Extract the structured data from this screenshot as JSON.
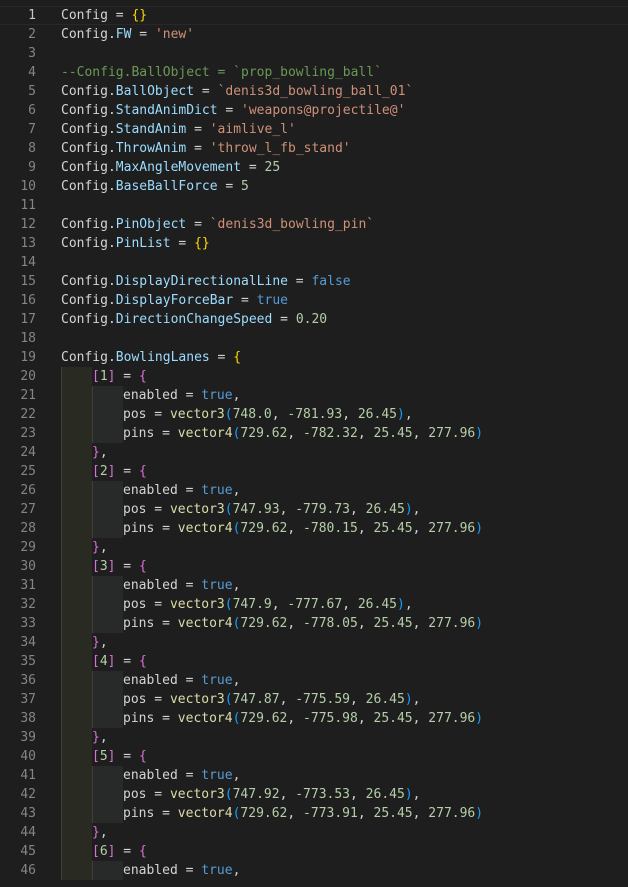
{
  "editor": {
    "current_line": "1",
    "lines": [
      {
        "n": "1",
        "indent": 0,
        "tokens": [
          [
            "id",
            "Config"
          ],
          [
            "op",
            " = "
          ],
          [
            "b1",
            "{}"
          ]
        ]
      },
      {
        "n": "2",
        "indent": 0,
        "tokens": [
          [
            "id",
            "Config"
          ],
          [
            "op",
            "."
          ],
          [
            "prop",
            "FW"
          ],
          [
            "op",
            " = "
          ],
          [
            "str",
            "'new'"
          ]
        ]
      },
      {
        "n": "3",
        "indent": 0,
        "tokens": []
      },
      {
        "n": "4",
        "indent": 0,
        "tokens": [
          [
            "cmt",
            "--Config.BallObject = `prop_bowling_ball`"
          ]
        ]
      },
      {
        "n": "5",
        "indent": 0,
        "tokens": [
          [
            "id",
            "Config"
          ],
          [
            "op",
            "."
          ],
          [
            "prop",
            "BallObject"
          ],
          [
            "op",
            " = "
          ],
          [
            "str",
            "`denis3d_bowling_ball_01`"
          ]
        ]
      },
      {
        "n": "6",
        "indent": 0,
        "tokens": [
          [
            "id",
            "Config"
          ],
          [
            "op",
            "."
          ],
          [
            "prop",
            "StandAnimDict"
          ],
          [
            "op",
            " = "
          ],
          [
            "str",
            "'weapons@projectile@'"
          ]
        ]
      },
      {
        "n": "7",
        "indent": 0,
        "tokens": [
          [
            "id",
            "Config"
          ],
          [
            "op",
            "."
          ],
          [
            "prop",
            "StandAnim"
          ],
          [
            "op",
            " = "
          ],
          [
            "str",
            "'aimlive_l'"
          ]
        ]
      },
      {
        "n": "8",
        "indent": 0,
        "tokens": [
          [
            "id",
            "Config"
          ],
          [
            "op",
            "."
          ],
          [
            "prop",
            "ThrowAnim"
          ],
          [
            "op",
            " = "
          ],
          [
            "str",
            "'throw_l_fb_stand'"
          ]
        ]
      },
      {
        "n": "9",
        "indent": 0,
        "tokens": [
          [
            "id",
            "Config"
          ],
          [
            "op",
            "."
          ],
          [
            "prop",
            "MaxAngleMovement"
          ],
          [
            "op",
            " = "
          ],
          [
            "num",
            "25"
          ]
        ]
      },
      {
        "n": "10",
        "indent": 0,
        "tokens": [
          [
            "id",
            "Config"
          ],
          [
            "op",
            "."
          ],
          [
            "prop",
            "BaseBallForce"
          ],
          [
            "op",
            " = "
          ],
          [
            "num",
            "5"
          ]
        ]
      },
      {
        "n": "11",
        "indent": 0,
        "tokens": []
      },
      {
        "n": "12",
        "indent": 0,
        "tokens": [
          [
            "id",
            "Config"
          ],
          [
            "op",
            "."
          ],
          [
            "prop",
            "PinObject"
          ],
          [
            "op",
            " = "
          ],
          [
            "str",
            "`denis3d_bowling_pin`"
          ]
        ]
      },
      {
        "n": "13",
        "indent": 0,
        "tokens": [
          [
            "id",
            "Config"
          ],
          [
            "op",
            "."
          ],
          [
            "prop",
            "PinList"
          ],
          [
            "op",
            " = "
          ],
          [
            "b1",
            "{}"
          ]
        ]
      },
      {
        "n": "14",
        "indent": 0,
        "tokens": []
      },
      {
        "n": "15",
        "indent": 0,
        "tokens": [
          [
            "id",
            "Config"
          ],
          [
            "op",
            "."
          ],
          [
            "prop",
            "DisplayDirectionalLine"
          ],
          [
            "op",
            " = "
          ],
          [
            "bool",
            "false"
          ]
        ]
      },
      {
        "n": "16",
        "indent": 0,
        "tokens": [
          [
            "id",
            "Config"
          ],
          [
            "op",
            "."
          ],
          [
            "prop",
            "DisplayForceBar"
          ],
          [
            "op",
            " = "
          ],
          [
            "bool",
            "true"
          ]
        ]
      },
      {
        "n": "17",
        "indent": 0,
        "tokens": [
          [
            "id",
            "Config"
          ],
          [
            "op",
            "."
          ],
          [
            "prop",
            "DirectionChangeSpeed"
          ],
          [
            "op",
            " = "
          ],
          [
            "num",
            "0.20"
          ]
        ]
      },
      {
        "n": "18",
        "indent": 0,
        "tokens": []
      },
      {
        "n": "19",
        "indent": 0,
        "tokens": [
          [
            "id",
            "Config"
          ],
          [
            "op",
            "."
          ],
          [
            "prop",
            "BowlingLanes"
          ],
          [
            "op",
            " = "
          ],
          [
            "b1",
            "{"
          ]
        ]
      },
      {
        "n": "20",
        "indent": 1,
        "tokens": [
          [
            "b2",
            "["
          ],
          [
            "num",
            "1"
          ],
          [
            "b2",
            "]"
          ],
          [
            "op",
            " = "
          ],
          [
            "b2",
            "{"
          ]
        ]
      },
      {
        "n": "21",
        "indent": 2,
        "tokens": [
          [
            "id",
            "enabled"
          ],
          [
            "op",
            " = "
          ],
          [
            "bool",
            "true"
          ],
          [
            "op",
            ","
          ]
        ]
      },
      {
        "n": "22",
        "indent": 2,
        "tokens": [
          [
            "id",
            "pos"
          ],
          [
            "op",
            " = "
          ],
          [
            "fn",
            "vector3"
          ],
          [
            "b3",
            "("
          ],
          [
            "num",
            "748.0"
          ],
          [
            "op",
            ", "
          ],
          [
            "num",
            "-781.93"
          ],
          [
            "op",
            ", "
          ],
          [
            "num",
            "26.45"
          ],
          [
            "b3",
            ")"
          ],
          [
            "op",
            ","
          ]
        ]
      },
      {
        "n": "23",
        "indent": 2,
        "tokens": [
          [
            "id",
            "pins"
          ],
          [
            "op",
            " = "
          ],
          [
            "fn",
            "vector4"
          ],
          [
            "b3",
            "("
          ],
          [
            "num",
            "729.62"
          ],
          [
            "op",
            ", "
          ],
          [
            "num",
            "-782.32"
          ],
          [
            "op",
            ", "
          ],
          [
            "num",
            "25.45"
          ],
          [
            "op",
            ", "
          ],
          [
            "num",
            "277.96"
          ],
          [
            "b3",
            ")"
          ]
        ]
      },
      {
        "n": "24",
        "indent": 1,
        "tokens": [
          [
            "b2",
            "}"
          ],
          [
            "op",
            ","
          ]
        ]
      },
      {
        "n": "25",
        "indent": 1,
        "tokens": [
          [
            "b2",
            "["
          ],
          [
            "num",
            "2"
          ],
          [
            "b2",
            "]"
          ],
          [
            "op",
            " = "
          ],
          [
            "b2",
            "{"
          ]
        ]
      },
      {
        "n": "26",
        "indent": 2,
        "tokens": [
          [
            "id",
            "enabled"
          ],
          [
            "op",
            " = "
          ],
          [
            "bool",
            "true"
          ],
          [
            "op",
            ","
          ]
        ]
      },
      {
        "n": "27",
        "indent": 2,
        "tokens": [
          [
            "id",
            "pos"
          ],
          [
            "op",
            " = "
          ],
          [
            "fn",
            "vector3"
          ],
          [
            "b3",
            "("
          ],
          [
            "num",
            "747.93"
          ],
          [
            "op",
            ", "
          ],
          [
            "num",
            "-779.73"
          ],
          [
            "op",
            ", "
          ],
          [
            "num",
            "26.45"
          ],
          [
            "b3",
            ")"
          ],
          [
            "op",
            ","
          ]
        ]
      },
      {
        "n": "28",
        "indent": 2,
        "tokens": [
          [
            "id",
            "pins"
          ],
          [
            "op",
            " = "
          ],
          [
            "fn",
            "vector4"
          ],
          [
            "b3",
            "("
          ],
          [
            "num",
            "729.62"
          ],
          [
            "op",
            ", "
          ],
          [
            "num",
            "-780.15"
          ],
          [
            "op",
            ", "
          ],
          [
            "num",
            "25.45"
          ],
          [
            "op",
            ", "
          ],
          [
            "num",
            "277.96"
          ],
          [
            "b3",
            ")"
          ]
        ]
      },
      {
        "n": "29",
        "indent": 1,
        "tokens": [
          [
            "b2",
            "}"
          ],
          [
            "op",
            ","
          ]
        ]
      },
      {
        "n": "30",
        "indent": 1,
        "tokens": [
          [
            "b2",
            "["
          ],
          [
            "num",
            "3"
          ],
          [
            "b2",
            "]"
          ],
          [
            "op",
            " = "
          ],
          [
            "b2",
            "{"
          ]
        ]
      },
      {
        "n": "31",
        "indent": 2,
        "tokens": [
          [
            "id",
            "enabled"
          ],
          [
            "op",
            " = "
          ],
          [
            "bool",
            "true"
          ],
          [
            "op",
            ","
          ]
        ]
      },
      {
        "n": "32",
        "indent": 2,
        "tokens": [
          [
            "id",
            "pos"
          ],
          [
            "op",
            " = "
          ],
          [
            "fn",
            "vector3"
          ],
          [
            "b3",
            "("
          ],
          [
            "num",
            "747.9"
          ],
          [
            "op",
            ", "
          ],
          [
            "num",
            "-777.67"
          ],
          [
            "op",
            ", "
          ],
          [
            "num",
            "26.45"
          ],
          [
            "b3",
            ")"
          ],
          [
            "op",
            ","
          ]
        ]
      },
      {
        "n": "33",
        "indent": 2,
        "tokens": [
          [
            "id",
            "pins"
          ],
          [
            "op",
            " = "
          ],
          [
            "fn",
            "vector4"
          ],
          [
            "b3",
            "("
          ],
          [
            "num",
            "729.62"
          ],
          [
            "op",
            ", "
          ],
          [
            "num",
            "-778.05"
          ],
          [
            "op",
            ", "
          ],
          [
            "num",
            "25.45"
          ],
          [
            "op",
            ", "
          ],
          [
            "num",
            "277.96"
          ],
          [
            "b3",
            ")"
          ]
        ]
      },
      {
        "n": "34",
        "indent": 1,
        "tokens": [
          [
            "b2",
            "}"
          ],
          [
            "op",
            ","
          ]
        ]
      },
      {
        "n": "35",
        "indent": 1,
        "tokens": [
          [
            "b2",
            "["
          ],
          [
            "num",
            "4"
          ],
          [
            "b2",
            "]"
          ],
          [
            "op",
            " = "
          ],
          [
            "b2",
            "{"
          ]
        ]
      },
      {
        "n": "36",
        "indent": 2,
        "tokens": [
          [
            "id",
            "enabled"
          ],
          [
            "op",
            " = "
          ],
          [
            "bool",
            "true"
          ],
          [
            "op",
            ","
          ]
        ]
      },
      {
        "n": "37",
        "indent": 2,
        "tokens": [
          [
            "id",
            "pos"
          ],
          [
            "op",
            " = "
          ],
          [
            "fn",
            "vector3"
          ],
          [
            "b3",
            "("
          ],
          [
            "num",
            "747.87"
          ],
          [
            "op",
            ", "
          ],
          [
            "num",
            "-775.59"
          ],
          [
            "op",
            ", "
          ],
          [
            "num",
            "26.45"
          ],
          [
            "b3",
            ")"
          ],
          [
            "op",
            ","
          ]
        ]
      },
      {
        "n": "38",
        "indent": 2,
        "tokens": [
          [
            "id",
            "pins"
          ],
          [
            "op",
            " = "
          ],
          [
            "fn",
            "vector4"
          ],
          [
            "b3",
            "("
          ],
          [
            "num",
            "729.62"
          ],
          [
            "op",
            ", "
          ],
          [
            "num",
            "-775.98"
          ],
          [
            "op",
            ", "
          ],
          [
            "num",
            "25.45"
          ],
          [
            "op",
            ", "
          ],
          [
            "num",
            "277.96"
          ],
          [
            "b3",
            ")"
          ]
        ]
      },
      {
        "n": "39",
        "indent": 1,
        "tokens": [
          [
            "b2",
            "}"
          ],
          [
            "op",
            ","
          ]
        ]
      },
      {
        "n": "40",
        "indent": 1,
        "tokens": [
          [
            "b2",
            "["
          ],
          [
            "num",
            "5"
          ],
          [
            "b2",
            "]"
          ],
          [
            "op",
            " = "
          ],
          [
            "b2",
            "{"
          ]
        ]
      },
      {
        "n": "41",
        "indent": 2,
        "tokens": [
          [
            "id",
            "enabled"
          ],
          [
            "op",
            " = "
          ],
          [
            "bool",
            "true"
          ],
          [
            "op",
            ","
          ]
        ]
      },
      {
        "n": "42",
        "indent": 2,
        "tokens": [
          [
            "id",
            "pos"
          ],
          [
            "op",
            " = "
          ],
          [
            "fn",
            "vector3"
          ],
          [
            "b3",
            "("
          ],
          [
            "num",
            "747.92"
          ],
          [
            "op",
            ", "
          ],
          [
            "num",
            "-773.53"
          ],
          [
            "op",
            ", "
          ],
          [
            "num",
            "26.45"
          ],
          [
            "b3",
            ")"
          ],
          [
            "op",
            ","
          ]
        ]
      },
      {
        "n": "43",
        "indent": 2,
        "tokens": [
          [
            "id",
            "pins"
          ],
          [
            "op",
            " = "
          ],
          [
            "fn",
            "vector4"
          ],
          [
            "b3",
            "("
          ],
          [
            "num",
            "729.62"
          ],
          [
            "op",
            ", "
          ],
          [
            "num",
            "-773.91"
          ],
          [
            "op",
            ", "
          ],
          [
            "num",
            "25.45"
          ],
          [
            "op",
            ", "
          ],
          [
            "num",
            "277.96"
          ],
          [
            "b3",
            ")"
          ]
        ]
      },
      {
        "n": "44",
        "indent": 1,
        "tokens": [
          [
            "b2",
            "}"
          ],
          [
            "op",
            ","
          ]
        ]
      },
      {
        "n": "45",
        "indent": 1,
        "tokens": [
          [
            "b2",
            "["
          ],
          [
            "num",
            "6"
          ],
          [
            "b2",
            "]"
          ],
          [
            "op",
            " = "
          ],
          [
            "b2",
            "{"
          ]
        ]
      },
      {
        "n": "46",
        "indent": 2,
        "tokens": [
          [
            "id",
            "enabled"
          ],
          [
            "op",
            " = "
          ],
          [
            "bool",
            "true"
          ],
          [
            "op",
            ","
          ]
        ]
      }
    ]
  }
}
